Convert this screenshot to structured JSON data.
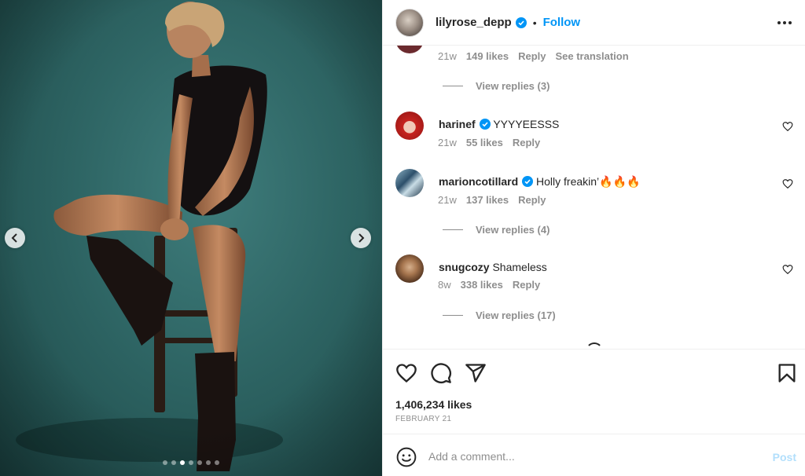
{
  "post": {
    "author": "lilyrose_depp",
    "separator": "•",
    "follow_label": "Follow",
    "likes": "1,406,234 likes",
    "date": "FEBRUARY 21",
    "carousel": {
      "count": 7,
      "active_index": 2
    }
  },
  "comments": {
    "top_partial": {
      "age": "21w",
      "likes": "149 likes",
      "reply": "Reply",
      "translate": "See translation",
      "view_replies": "View replies (3)"
    },
    "items": [
      {
        "username": "harinef",
        "verified": true,
        "text": "YYYYEESSS",
        "age": "21w",
        "likes": "55 likes",
        "reply": "Reply",
        "view_replies": ""
      },
      {
        "username": "marioncotillard",
        "verified": true,
        "text": "Holly freakin’🔥🔥🔥",
        "age": "21w",
        "likes": "137 likes",
        "reply": "Reply",
        "view_replies": "View replies (4)"
      },
      {
        "username": "snugcozy",
        "verified": false,
        "text": "Shameless",
        "age": "8w",
        "likes": "338 likes",
        "reply": "Reply",
        "view_replies": "View replies (17)"
      }
    ]
  },
  "composer": {
    "placeholder": "Add a comment...",
    "post_label": "Post"
  },
  "colors": {
    "accent": "#0095f6",
    "post_disabled": "#b2dffc",
    "muted": "#8e8e8e",
    "text": "#262626"
  },
  "icons": [
    "chevron-left-icon",
    "chevron-right-icon",
    "verified-badge-icon",
    "more-options-icon",
    "heart-icon",
    "comment-icon",
    "share-icon",
    "bookmark-icon",
    "emoji-icon"
  ]
}
